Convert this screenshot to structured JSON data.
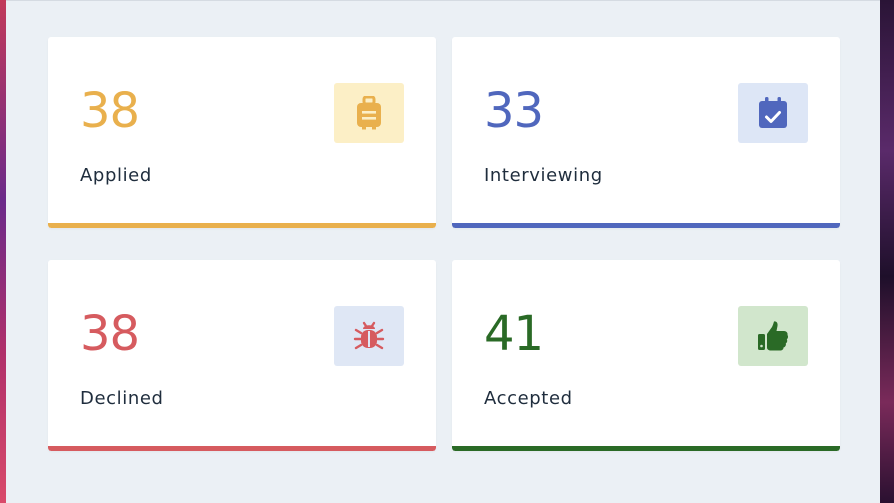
{
  "stats": [
    {
      "count": "38",
      "label": "Applied",
      "icon": "suitcase-icon",
      "color": "#e9b04d",
      "icon_bg": "#fcefc6"
    },
    {
      "count": "33",
      "label": "Interviewing",
      "icon": "calendar-check-icon",
      "color": "#5067bd",
      "icon_bg": "#dde6f6"
    },
    {
      "count": "38",
      "label": "Declined",
      "icon": "bug-icon",
      "color": "#d65b5f",
      "icon_bg": "#dfe7f5"
    },
    {
      "count": "41",
      "label": "Accepted",
      "icon": "thumbs-up-icon",
      "color": "#2a6a26",
      "icon_bg": "#d1e6cc"
    }
  ]
}
